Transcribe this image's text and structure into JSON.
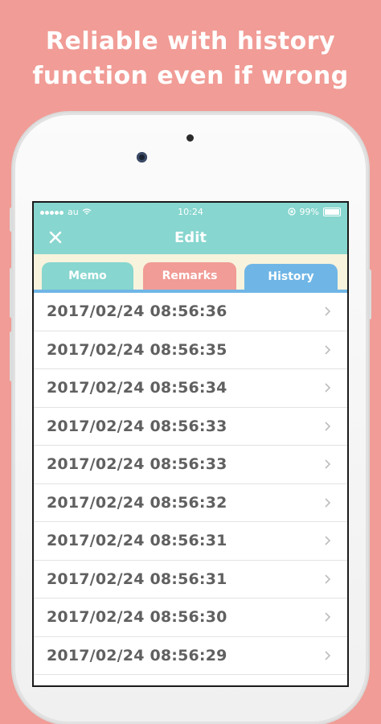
{
  "promo": {
    "line1": "Reliable with history",
    "line2": "function even if wrong"
  },
  "status_bar": {
    "carrier": "au",
    "time": "10:24",
    "battery": "99%"
  },
  "navbar": {
    "title": "Edit",
    "close_icon": "close-icon"
  },
  "tabs": [
    {
      "label": "Memo"
    },
    {
      "label": "Remarks"
    },
    {
      "label": "History",
      "selected": true
    }
  ],
  "history": [
    {
      "timestamp": "2017/02/24 08:56:36"
    },
    {
      "timestamp": "2017/02/24 08:56:35"
    },
    {
      "timestamp": "2017/02/24 08:56:34"
    },
    {
      "timestamp": "2017/02/24 08:56:33"
    },
    {
      "timestamp": "2017/02/24 08:56:33"
    },
    {
      "timestamp": "2017/02/24 08:56:32"
    },
    {
      "timestamp": "2017/02/24 08:56:31"
    },
    {
      "timestamp": "2017/02/24 08:56:31"
    },
    {
      "timestamp": "2017/02/24 08:56:30"
    },
    {
      "timestamp": "2017/02/24 08:56:29"
    }
  ],
  "colors": {
    "background": "#f19c96",
    "teal": "#87d6cf",
    "blue": "#6fb6e6",
    "pink": "#f19c96",
    "tab_bg": "#f8f3dd"
  }
}
